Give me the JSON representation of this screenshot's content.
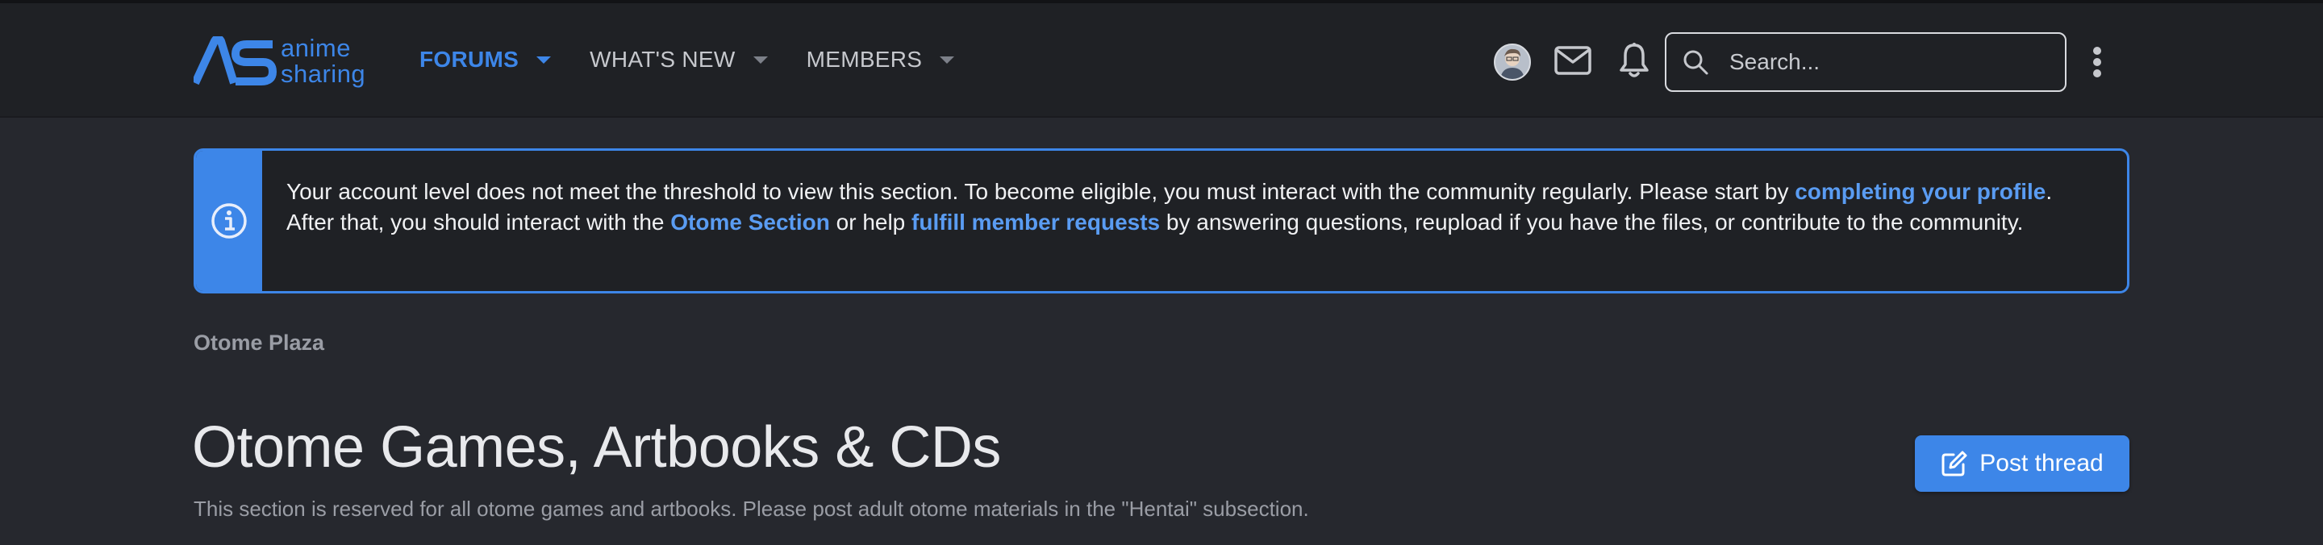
{
  "brand": {
    "logo_mark": "AS",
    "line1": "anime",
    "line2": "sharing",
    "accent": "#3d86e8"
  },
  "nav": [
    {
      "label": "FORUMS",
      "active": true
    },
    {
      "label": "WHAT'S NEW",
      "active": false
    },
    {
      "label": "MEMBERS",
      "active": false
    }
  ],
  "header_icons": [
    "avatar",
    "mail-icon",
    "bell-icon",
    "more-vertical-icon"
  ],
  "search": {
    "placeholder": "Search..."
  },
  "notice": {
    "text1": "Your account level does not meet the threshold to view this section. To become eligible, you must interact with the community regularly. Please start by ",
    "link1": "completing your profile",
    "text2": ". After that, you should interact with the ",
    "link2": "Otome Section",
    "text3": " or help ",
    "link3": "fulfill member requests",
    "text4": " by answering questions, reupload if you have the files, or contribute to the community.",
    "icon": "info-circle-icon"
  },
  "breadcrumb": "Otome Plaza",
  "page": {
    "title": "Otome Games, Artbooks & CDs",
    "description": "This section is reserved for all otome games and artbooks. Please post adult otome materials in the \"Hentai\" subsection."
  },
  "post_button": {
    "label": "Post thread",
    "icon": "edit-icon"
  }
}
